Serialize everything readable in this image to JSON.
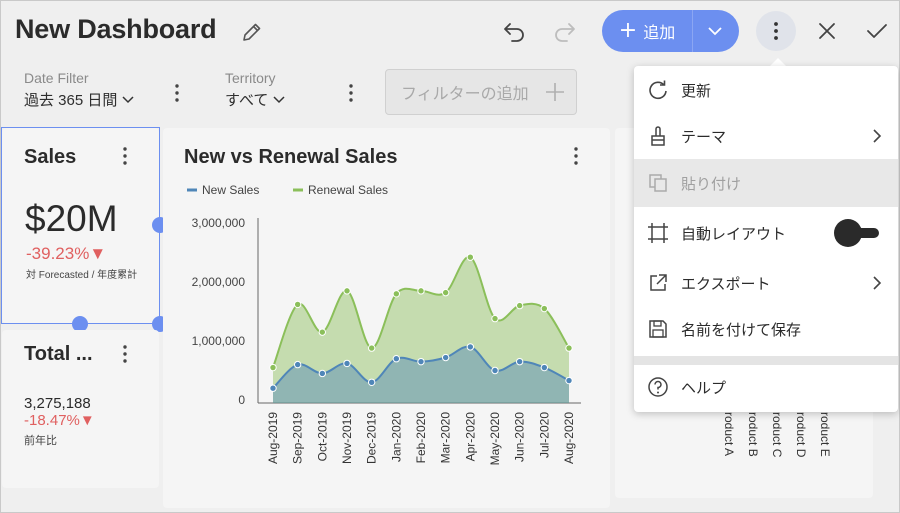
{
  "header": {
    "title": "New Dashboard",
    "add_label": "追加"
  },
  "filters": [
    {
      "label": "Date Filter",
      "value": "過去 365 日間"
    },
    {
      "label": "Territory",
      "value": "すべて"
    }
  ],
  "add_filter": {
    "label": "フィルターの追加"
  },
  "sales_card": {
    "title": "Sales",
    "value": "$20M",
    "change": "-39.23%▼",
    "caption": "対 Forecasted / 年度累計"
  },
  "total_card": {
    "title": "Total ...",
    "value": "3,275,188",
    "change": "-18.47%▼",
    "caption": "前年比"
  },
  "chart_card": {
    "title": "New vs Renewal Sales"
  },
  "chart_data": {
    "type": "area",
    "title": "New vs Renewal Sales",
    "categories": [
      "Aug-2019",
      "Sep-2019",
      "Oct-2019",
      "Nov-2019",
      "Dec-2019",
      "Jan-2020",
      "Feb-2020",
      "Mar-2020",
      "Apr-2020",
      "May-2020",
      "Jun-2020",
      "Jul-2020",
      "Aug-2020"
    ],
    "series": [
      {
        "name": "New Sales",
        "color": "#4f86b8",
        "values": [
          200000,
          600000,
          450000,
          620000,
          300000,
          700000,
          650000,
          720000,
          900000,
          500000,
          650000,
          550000,
          330000
        ]
      },
      {
        "name": "Renewal Sales",
        "color": "#8bbf5a",
        "values": [
          550000,
          1620000,
          1150000,
          1850000,
          880000,
          1800000,
          1850000,
          1820000,
          2420000,
          1380000,
          1600000,
          1550000,
          880000
        ]
      }
    ],
    "yticks": [
      "3,000,000",
      "2,000,000",
      "1,000,000",
      "0"
    ],
    "ylim": [
      0,
      3000000
    ],
    "legend": "top-left"
  },
  "right_card": {
    "products": [
      "Product A",
      "Product B",
      "Product C",
      "Product D",
      "Product E"
    ]
  },
  "menu": {
    "items": [
      {
        "label": "更新",
        "icon": "refresh-icon"
      },
      {
        "label": "テーマ",
        "icon": "brush-icon"
      },
      {
        "label": "貼り付け",
        "icon": "paste-icon"
      },
      {
        "label": "自動レイアウト",
        "icon": "auto-layout-icon"
      },
      {
        "label": "エクスポート",
        "icon": "export-icon"
      },
      {
        "label": "名前を付けて保存",
        "icon": "save-icon"
      },
      {
        "label": "ヘルプ",
        "icon": "help-icon"
      }
    ]
  },
  "colors": {
    "accent": "#6c8ff0",
    "negative": "#e06060",
    "new_sales": "#4f86b8",
    "renewal_sales": "#8bbf5a"
  }
}
